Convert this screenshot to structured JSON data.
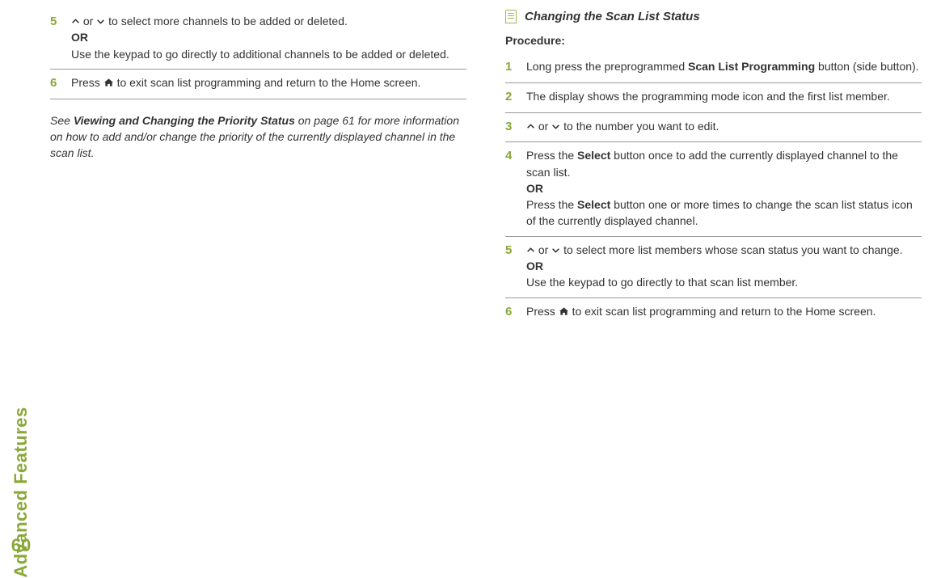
{
  "sidebar": {
    "label": "Advanced Features",
    "page_number": "60"
  },
  "left_col": {
    "steps": [
      {
        "num": "5",
        "lines": [
          {
            "type": "arrow-both",
            "text": " to select more channels to be added or deleted."
          },
          {
            "type": "or",
            "text": "OR"
          },
          {
            "type": "plain",
            "text": "Use the keypad to go directly to additional channels to be added or deleted."
          }
        ]
      },
      {
        "num": "6",
        "lines": [
          {
            "type": "press-home",
            "prefix": "Press ",
            "suffix": " to exit scan list programming and return to the Home screen."
          }
        ]
      }
    ],
    "note": {
      "pre": "See ",
      "bold": "Viewing and Changing the Priority Status",
      "post": " on page 61 for more information on how to add and/or change the priority of the currently displayed channel in the scan list."
    }
  },
  "right_col": {
    "section_title": "Changing the Scan List Status",
    "procedure_label": "Procedure:",
    "steps": [
      {
        "num": "1",
        "lines": [
          {
            "type": "rich",
            "parts": [
              {
                "t": "Long press the preprogrammed "
              },
              {
                "t": "Scan List Programming",
                "b": true
              },
              {
                "t": " button (side button)."
              }
            ]
          }
        ]
      },
      {
        "num": "2",
        "lines": [
          {
            "type": "plain",
            "text": "The display shows the programming mode icon and the first list member."
          }
        ]
      },
      {
        "num": "3",
        "lines": [
          {
            "type": "arrow-both",
            "text": " to the number you want to edit."
          }
        ]
      },
      {
        "num": "4",
        "lines": [
          {
            "type": "rich",
            "parts": [
              {
                "t": "Press the "
              },
              {
                "t": "Select",
                "b": true
              },
              {
                "t": " button once to add the currently displayed channel to the scan list."
              }
            ]
          },
          {
            "type": "or",
            "text": "OR"
          },
          {
            "type": "rich",
            "parts": [
              {
                "t": "Press the "
              },
              {
                "t": "Select",
                "b": true
              },
              {
                "t": " button one or more times to change the scan list status icon of the currently displayed channel."
              }
            ]
          }
        ]
      },
      {
        "num": "5",
        "lines": [
          {
            "type": "arrow-both",
            "text": " to select more list members whose scan status you want to change."
          },
          {
            "type": "or",
            "text": "OR"
          },
          {
            "type": "plain",
            "text": "Use the keypad to go directly to that scan list member."
          }
        ]
      },
      {
        "num": "6",
        "lines": [
          {
            "type": "press-home",
            "prefix": "Press ",
            "suffix": " to exit scan list programming and return to the Home screen."
          }
        ]
      }
    ]
  }
}
